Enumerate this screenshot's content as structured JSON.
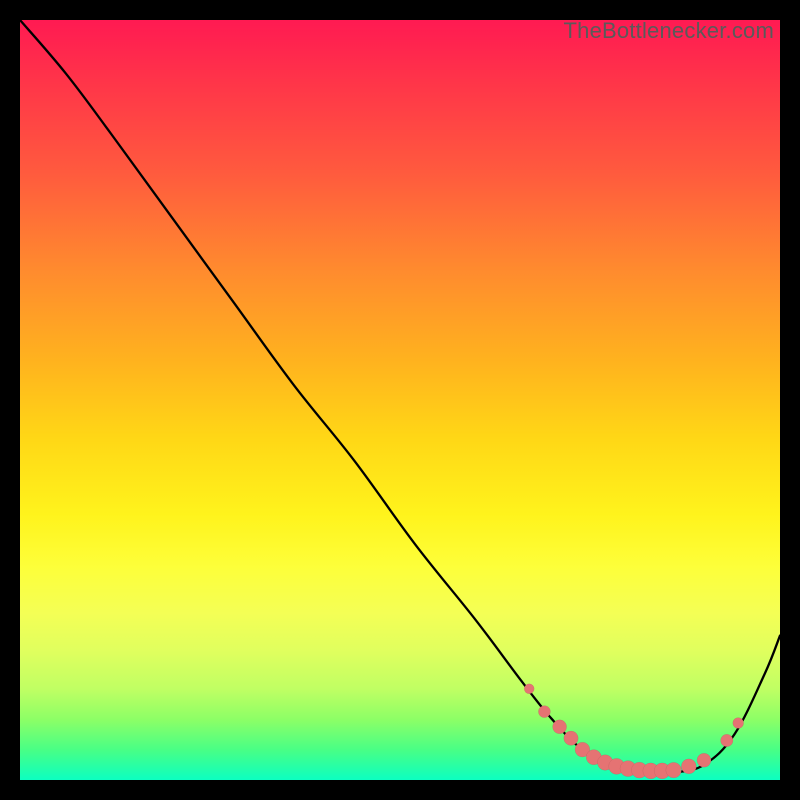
{
  "watermark": "TheBottlenecker.com",
  "colors": {
    "curve": "#000000",
    "dot": "#e57373",
    "background_top": "#ff1a52",
    "background_bottom": "#0cffc1"
  },
  "chart_data": {
    "type": "line",
    "title": "",
    "xlabel": "",
    "ylabel": "",
    "xlim": [
      0,
      100
    ],
    "ylim": [
      0,
      100
    ],
    "grid": false,
    "series": [
      {
        "name": "curve",
        "x": [
          0,
          6,
          12,
          20,
          28,
          36,
          44,
          52,
          60,
          66,
          70,
          74,
          78,
          82,
          86,
          90,
          94,
          98,
          100
        ],
        "y": [
          100,
          93,
          85,
          74,
          63,
          52,
          42,
          31,
          21,
          13,
          8,
          4,
          2,
          1,
          1,
          2,
          6,
          14,
          19
        ]
      }
    ],
    "markers": {
      "name": "highlight-dots",
      "x": [
        67,
        69,
        71,
        72.5,
        74,
        75.5,
        77,
        78.5,
        80,
        81.5,
        83,
        84.5,
        86,
        88,
        90,
        93,
        94.5
      ],
      "y": [
        12,
        9,
        7,
        5.5,
        4,
        3,
        2.3,
        1.8,
        1.5,
        1.3,
        1.2,
        1.2,
        1.3,
        1.8,
        2.6,
        5.2,
        7.5
      ],
      "r": [
        5,
        6,
        7,
        7.2,
        7.4,
        7.6,
        7.8,
        8,
        8,
        8,
        8,
        8,
        7.8,
        7.5,
        7,
        6.2,
        5.4
      ]
    }
  }
}
